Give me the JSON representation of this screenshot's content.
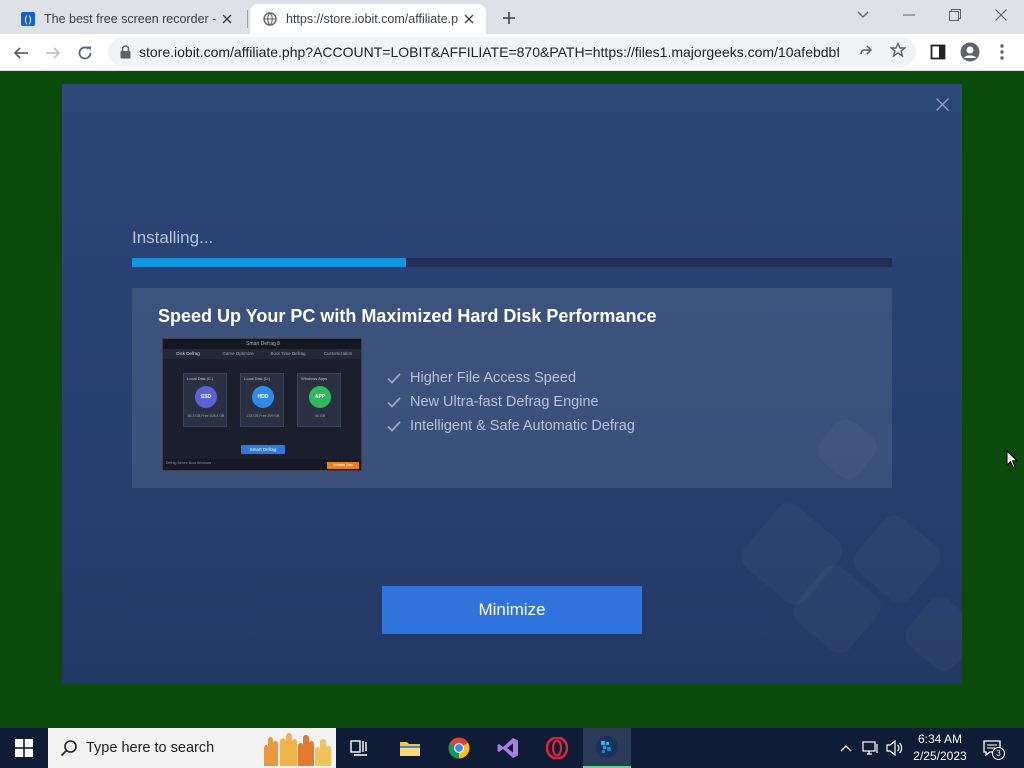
{
  "browser": {
    "tabs": [
      {
        "title": "The best free screen recorder - iT",
        "favicon": "blue-bracket-icon",
        "active": false
      },
      {
        "title": "https://store.iobit.com/affiliate.p",
        "favicon": "globe-icon",
        "active": true
      }
    ],
    "url": "store.iobit.com/affiliate.php?ACCOUNT=LOBIT&AFFILIATE=870&PATH=https://files1.majorgeeks.com/10afebdbf..."
  },
  "dialog": {
    "status": "Installing...",
    "progress": 0.36,
    "promo_title": "Speed Up Your PC with Maximized Hard Disk Performance",
    "features": [
      "Higher File Access Speed",
      "New Ultra-fast Defrag Engine",
      "Intelligent & Safe Automatic Defrag"
    ],
    "minimize_label": "Minimize",
    "screenshot": {
      "app_title": "Smart Defrag 8",
      "tabs": [
        "Disk Defrag",
        "Game Optimize",
        "Boot Time Defrag",
        "Customization"
      ],
      "drives": [
        {
          "label": "Local Disk (C:)",
          "badge": "SSD",
          "sub": "56.3 GB Free 105.4 GB"
        },
        {
          "label": "Local Disk (D:)",
          "badge": "HDD",
          "sub": "218 GB Free 299 GB"
        },
        {
          "label": "Windows Apps",
          "badge": "APP",
          "sub": "96 GB"
        }
      ],
      "primary_action": "Smart Defrag",
      "footer_text": "Defrag Before Boot Windows",
      "footer_action": "Activate Now"
    }
  },
  "taskbar": {
    "search_placeholder": "Type here to search",
    "time": "6:34 AM",
    "date": "2/25/2023",
    "notification_count": "3"
  },
  "colors": {
    "accent": "#2f74dc",
    "progress": "#1296e0",
    "page_background": "#0a4a0a"
  }
}
